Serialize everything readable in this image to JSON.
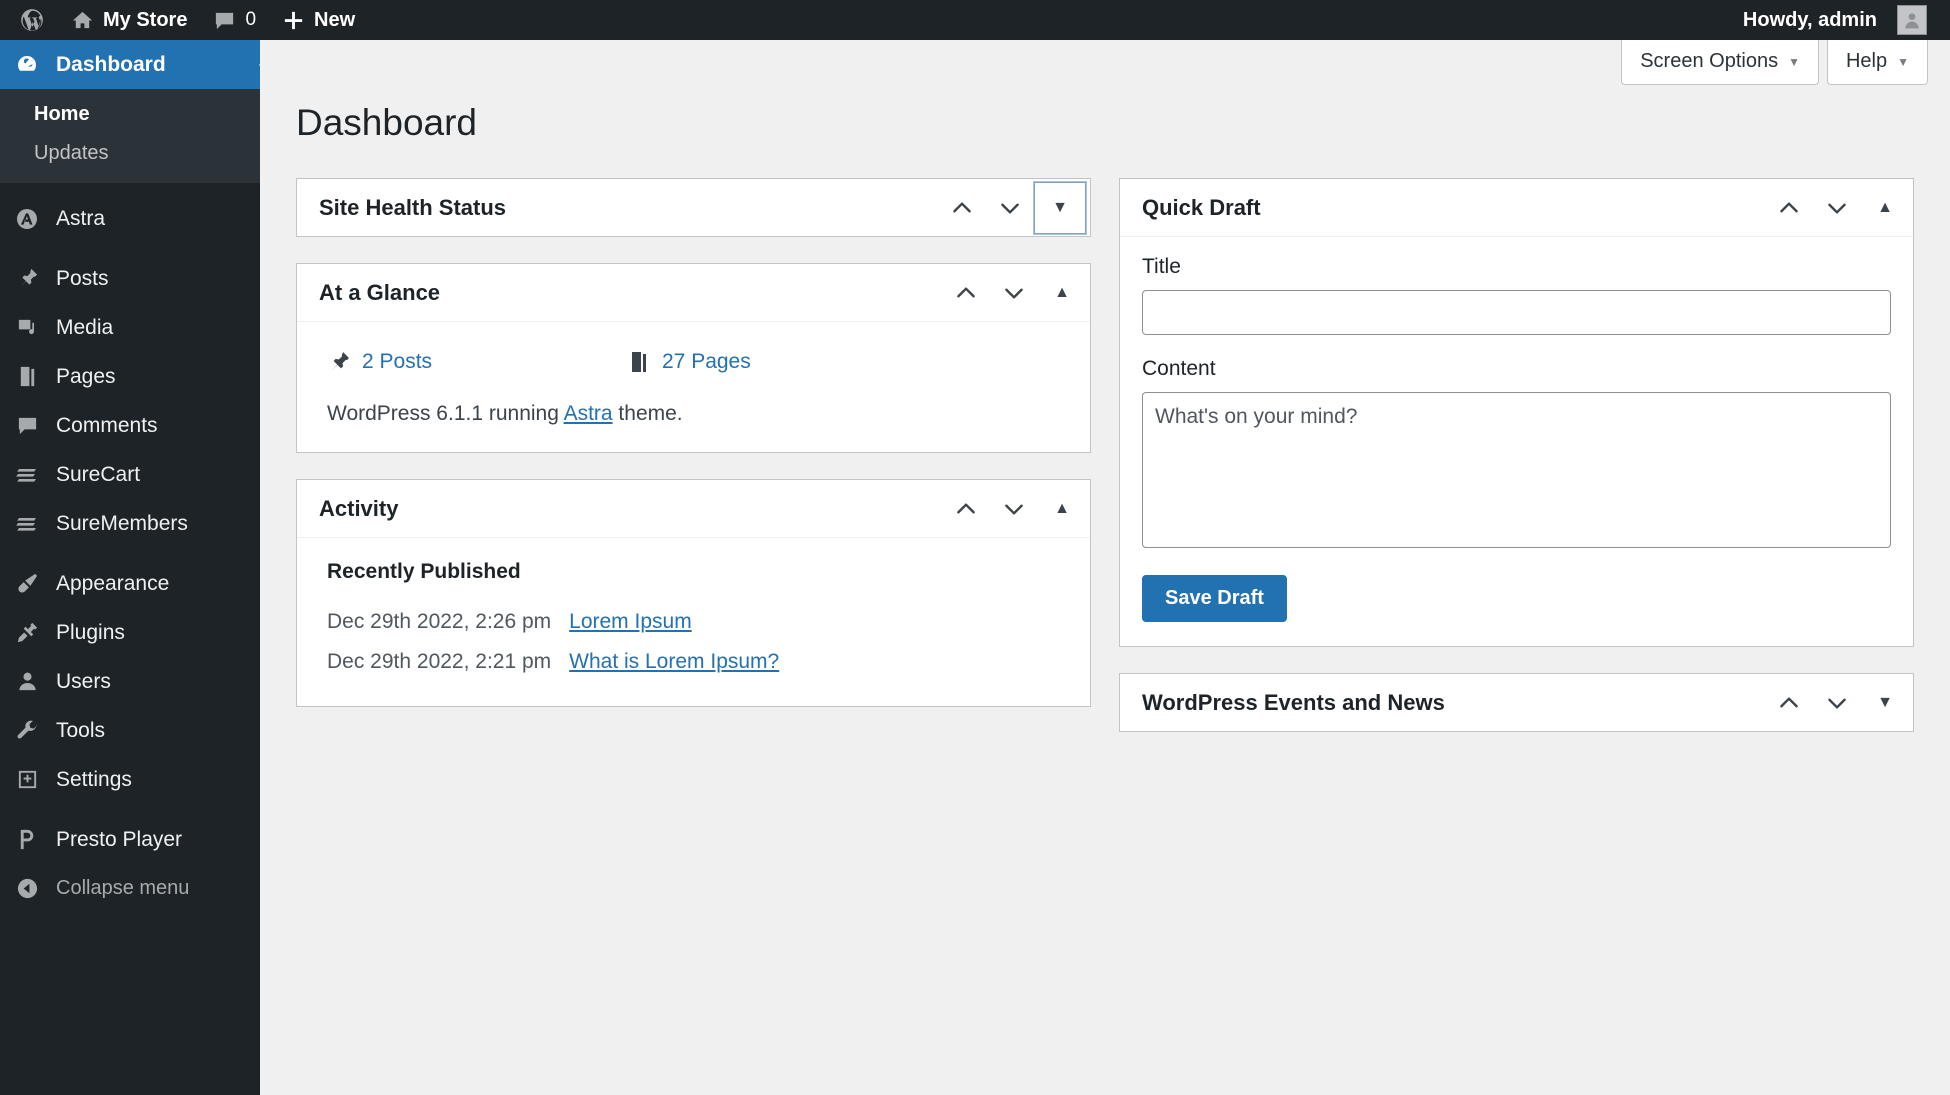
{
  "adminbar": {
    "logo_icon": "wordpress-logo-icon",
    "site_name": "My Store",
    "site_icon": "home-icon",
    "comments_icon": "comment-bubble-icon",
    "comments_count": "0",
    "new_icon": "plus-icon",
    "new_label": "New",
    "howdy": "Howdy, admin",
    "avatar_icon": "avatar-icon"
  },
  "sidebar": {
    "items": [
      {
        "label": "Dashboard",
        "icon": "dashboard-icon",
        "current": true
      },
      {
        "label": "Astra",
        "icon": "astra-icon",
        "current": false
      },
      {
        "label": "Posts",
        "icon": "pushpin-icon",
        "current": false
      },
      {
        "label": "Media",
        "icon": "media-icon",
        "current": false
      },
      {
        "label": "Pages",
        "icon": "pages-icon",
        "current": false
      },
      {
        "label": "Comments",
        "icon": "comment-bubble-icon",
        "current": false
      },
      {
        "label": "SureCart",
        "icon": "surecart-icon",
        "current": false
      },
      {
        "label": "SureMembers",
        "icon": "suremembers-icon",
        "current": false
      },
      {
        "label": "Appearance",
        "icon": "paintbrush-icon",
        "current": false
      },
      {
        "label": "Plugins",
        "icon": "plug-icon",
        "current": false
      },
      {
        "label": "Users",
        "icon": "user-icon",
        "current": false
      },
      {
        "label": "Tools",
        "icon": "wrench-icon",
        "current": false
      },
      {
        "label": "Settings",
        "icon": "settings-sliders-icon",
        "current": false
      },
      {
        "label": "Presto Player",
        "icon": "presto-player-icon",
        "current": false
      }
    ],
    "submenu": [
      {
        "label": "Home",
        "current": true
      },
      {
        "label": "Updates",
        "current": false
      }
    ],
    "collapse": {
      "label": "Collapse menu",
      "icon": "collapse-arrow-icon"
    }
  },
  "screen_meta": {
    "screen_options_label": "Screen Options",
    "help_label": "Help",
    "caret_icon": "chevron-down-icon"
  },
  "page": {
    "title": "Dashboard"
  },
  "panels": {
    "site_health": {
      "title": "Site Health Status",
      "collapsed": true,
      "order_up_icon": "chevron-up-icon",
      "order_down_icon": "chevron-down-icon",
      "toggle_icon": "triangle-down-icon"
    },
    "at_a_glance": {
      "title": "At a Glance",
      "order_up_icon": "chevron-up-icon",
      "order_down_icon": "chevron-down-icon",
      "toggle_icon": "triangle-up-icon",
      "stats": [
        {
          "icon": "pushpin-icon",
          "label": "2 Posts"
        },
        {
          "icon": "pages-icon",
          "label": "27 Pages"
        }
      ],
      "version_prefix": "WordPress 6.1.1 running ",
      "theme_link": "Astra",
      "version_suffix": " theme."
    },
    "activity": {
      "title": "Activity",
      "order_up_icon": "chevron-up-icon",
      "order_down_icon": "chevron-down-icon",
      "toggle_icon": "triangle-up-icon",
      "section_title": "Recently Published",
      "rows": [
        {
          "date": "Dec 29th 2022, 2:26 pm",
          "title": "Lorem Ipsum"
        },
        {
          "date": "Dec 29th 2022, 2:21 pm",
          "title": "What is Lorem Ipsum?"
        }
      ]
    },
    "quick_draft": {
      "title": "Quick Draft",
      "order_up_icon": "chevron-up-icon",
      "order_down_icon": "chevron-down-icon",
      "toggle_icon": "triangle-up-icon",
      "title_label": "Title",
      "title_value": "",
      "title_placeholder": "",
      "content_label": "Content",
      "content_placeholder": "What's on your mind?",
      "content_value": "",
      "save_label": "Save Draft"
    },
    "events_news": {
      "title": "WordPress Events and News",
      "collapsed": true,
      "order_up_icon": "chevron-up-icon",
      "order_down_icon": "chevron-down-icon",
      "toggle_icon": "triangle-down-icon"
    }
  },
  "colors": {
    "admin_bar": "#1d2327",
    "sidebar": "#1d2327",
    "submenu": "#2c3338",
    "accent": "#2271b1",
    "content_bg": "#f0f0f1",
    "link": "#2271b1"
  }
}
